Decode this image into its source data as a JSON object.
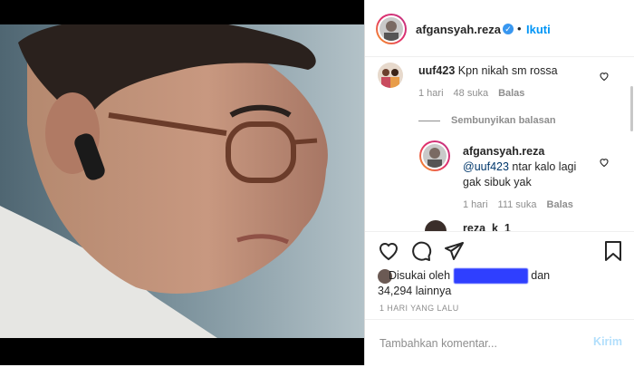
{
  "header": {
    "username": "afgansyah.reza",
    "separator": "•",
    "follow_label": "Ikuti",
    "verified_icon": "verified-badge-icon"
  },
  "comments": [
    {
      "username": "uuf423",
      "text": "Kpn nikah sm rossa",
      "time": "1 hari",
      "likes": "48 suka",
      "reply_label": "Balas"
    }
  ],
  "hide_replies_label": "Sembunyikan balasan",
  "reply": {
    "username": "afgansyah.reza",
    "mention": "@uuf423",
    "text": " ntar kalo lagi gak sibuk yak",
    "time": "1 hari",
    "likes": "111 suka",
    "reply_label": "Balas"
  },
  "partial_next_user": "reza_k_1",
  "likes": {
    "prefix": "Disukai oleh",
    "blurred_user": "blurred_user",
    "conj": "dan",
    "count": "34,294 lainnya"
  },
  "post_date": "1 HARI YANG LALU",
  "comment_box": {
    "placeholder": "Tambahkan komentar...",
    "post_label": "Kirim"
  },
  "colors": {
    "accent": "#0095f6",
    "verified": "#3897f0",
    "muted": "#8e8e8e"
  }
}
